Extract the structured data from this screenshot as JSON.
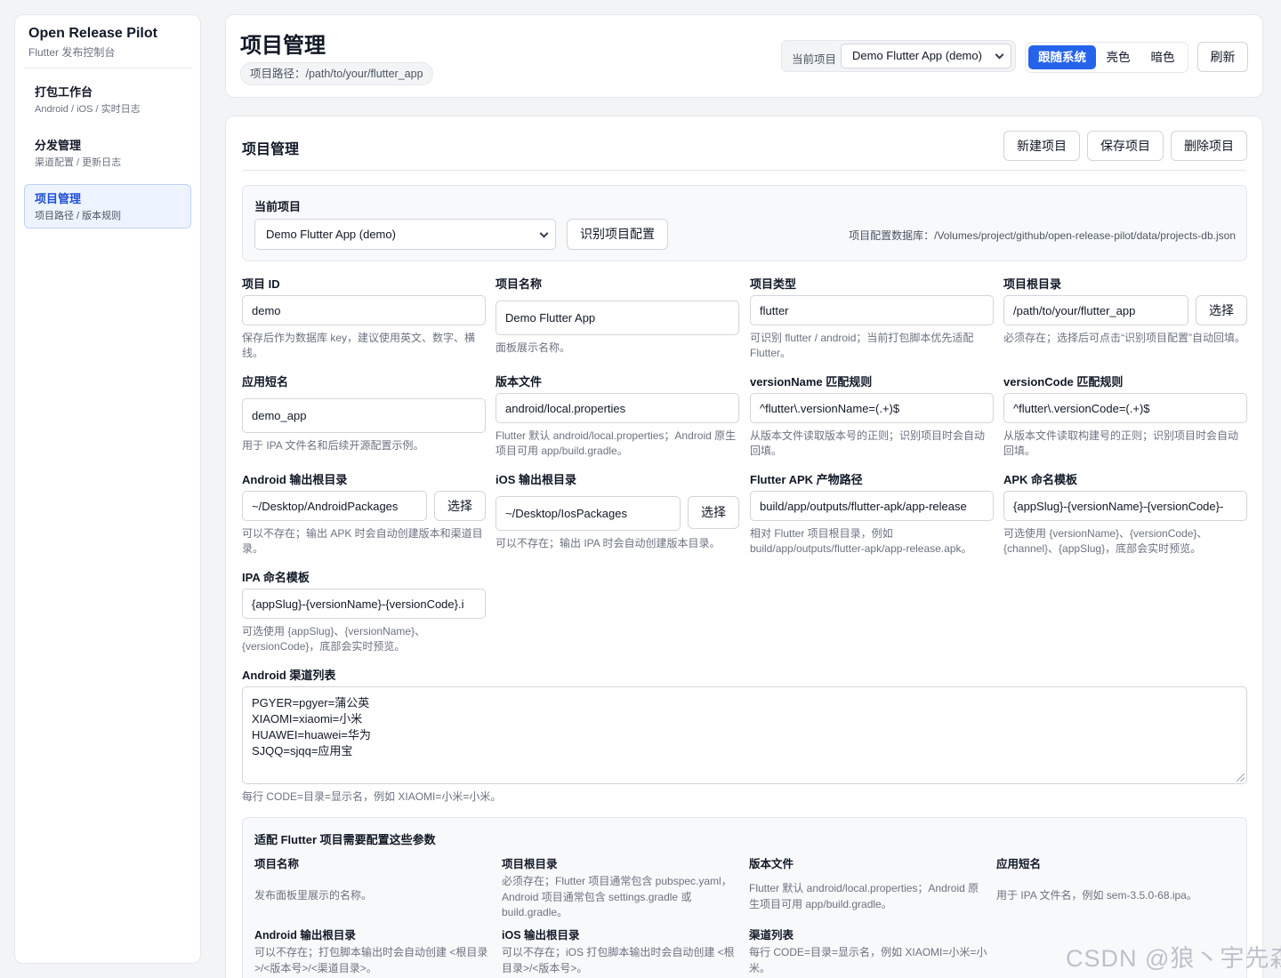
{
  "sidebar": {
    "brand_title": "Open Release Pilot",
    "brand_subtitle": "Flutter 发布控制台",
    "items": [
      {
        "label": "打包工作台",
        "sub": "Android / iOS / 实时日志"
      },
      {
        "label": "分发管理",
        "sub": "渠道配置 / 更新日志"
      },
      {
        "label": "项目管理",
        "sub": "项目路径 / 版本规则"
      }
    ],
    "active_index": 2
  },
  "header": {
    "title": "项目管理",
    "path": "项目路径：/path/to/your/flutter_app",
    "current_project_label": "当前项目",
    "current_project_value": "Demo Flutter App (demo)",
    "theme_options": [
      "跟随系统",
      "亮色",
      "暗色"
    ],
    "theme_selected": "跟随系统",
    "refresh_label": "刷新"
  },
  "main": {
    "title": "项目管理",
    "new_label": "新建项目",
    "save_label": "保存项目",
    "delete_label": "删除项目",
    "panel": {
      "label": "当前项目",
      "select_value": "Demo Flutter App (demo)",
      "detect_label": "识别项目配置",
      "db_path": "项目配置数据库：/Volumes/project/github/open-release-pilot/data/projects-db.json"
    },
    "choose_label": "选择",
    "fields": {
      "project_id": {
        "label": "项目 ID",
        "value": "demo",
        "help": "保存后作为数据库 key，建议使用英文、数字、横线。"
      },
      "project_name": {
        "label": "项目名称",
        "value": "Demo Flutter App",
        "help": "面板展示名称。"
      },
      "project_type": {
        "label": "项目类型",
        "value": "flutter",
        "help": "可识别 flutter / android；当前打包脚本优先适配 Flutter。"
      },
      "project_root": {
        "label": "项目根目录",
        "value": "/path/to/your/flutter_app",
        "help": "必须存在；选择后可点击“识别项目配置”自动回填。"
      },
      "app_slug": {
        "label": "应用短名",
        "value": "demo_app",
        "help": "用于 IPA 文件名和后续开源配置示例。"
      },
      "version_file": {
        "label": "版本文件",
        "value": "android/local.properties",
        "help": "Flutter 默认 android/local.properties；Android 原生项目可用 app/build.gradle。"
      },
      "version_name_rule": {
        "label": "versionName 匹配规则",
        "value": "^flutter\\.versionName=(.+)$",
        "help": "从版本文件读取版本号的正则；识别项目时会自动回填。"
      },
      "version_code_rule": {
        "label": "versionCode 匹配规则",
        "value": "^flutter\\.versionCode=(.+)$",
        "help": "从版本文件读取构建号的正则；识别项目时会自动回填。"
      },
      "android_output": {
        "label": "Android 输出根目录",
        "value": "~/Desktop/AndroidPackages",
        "help": "可以不存在；输出 APK 时会自动创建版本和渠道目录。"
      },
      "ios_output": {
        "label": "iOS 输出根目录",
        "value": "~/Desktop/IosPackages",
        "help": "可以不存在；输出 IPA 时会自动创建版本目录。"
      },
      "flutter_apk_path": {
        "label": "Flutter APK 产物路径",
        "value": "build/app/outputs/flutter-apk/app-release",
        "help": "相对 Flutter 项目根目录，例如 build/app/outputs/flutter-apk/app-release.apk。"
      },
      "apk_template": {
        "label": "APK 命名模板",
        "value": "{appSlug}-{versionName}-{versionCode}-",
        "help": "可选使用 {versionName}、{versionCode}、{channel}、{appSlug}，底部会实时预览。"
      },
      "ipa_template": {
        "label": "IPA 命名模板",
        "value": "{appSlug}-{versionName}-{versionCode}.i",
        "help": "可选使用 {appSlug}、{versionName}、{versionCode}，底部会实时预览。"
      }
    },
    "channels": {
      "label": "Android 渠道列表",
      "lines": [
        "PGYER=pgyer=蒲公英",
        "XIAOMI=xiaomi=小米",
        "HUAWEI=huawei=华为",
        "SJQQ=sjqq=应用宝"
      ],
      "help": "每行 CODE=目录=显示名，例如 XIAOMI=小米=小米。"
    },
    "info": {
      "title": "适配 Flutter 项目需要配置这些参数",
      "items": [
        {
          "title": "项目名称",
          "text": "发布面板里展示的名称。"
        },
        {
          "title": "项目根目录",
          "text": "必须存在；Flutter 项目通常包含 pubspec.yaml，Android 项目通常包含 settings.gradle 或 build.gradle。"
        },
        {
          "title": "版本文件",
          "text": "Flutter 默认 android/local.properties；Android 原生项目可用 app/build.gradle。"
        },
        {
          "title": "应用短名",
          "text": "用于 IPA 文件名，例如 sem-3.5.0-68.ipa。"
        },
        {
          "title": "Android 输出根目录",
          "text": "可以不存在；打包脚本输出时会自动创建 <根目录>/<版本号>/<渠道目录>。"
        },
        {
          "title": "iOS 输出根目录",
          "text": "可以不存在；iOS 打包脚本输出时会自动创建 <根目录>/<版本号>。"
        },
        {
          "title": "渠道列表",
          "text": "每行 CODE=目录=显示名，例如 XIAOMI=小米=小米。"
        }
      ]
    }
  },
  "watermark": "CSDN @狼丶宇先森"
}
